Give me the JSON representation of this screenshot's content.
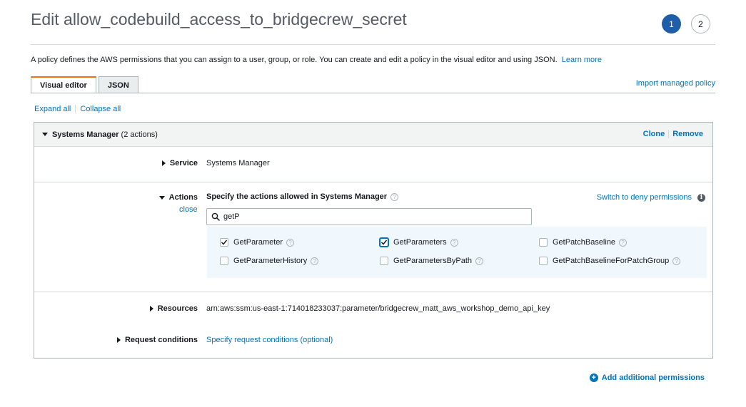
{
  "page": {
    "title": "Edit allow_codebuild_access_to_bridgecrew_secret",
    "steps": [
      "1",
      "2"
    ],
    "intro": "A policy defines the AWS permissions that you can assign to a user, group, or role. You can create and edit a policy in the visual editor and using JSON.",
    "learn_more": "Learn more"
  },
  "tabs": [
    {
      "label": "Visual editor",
      "active": true
    },
    {
      "label": "JSON",
      "active": false
    }
  ],
  "import_link": "Import managed policy",
  "expand_all": "Expand all",
  "collapse_all": "Collapse all",
  "panel": {
    "service_name": "Systems Manager",
    "action_count": "(2 actions)",
    "clone": "Clone",
    "remove": "Remove",
    "service_label": "Service",
    "service_value": "Systems Manager",
    "actions_label": "Actions",
    "close": "close",
    "actions_heading": "Specify the actions allowed in Systems Manager",
    "deny_link": "Switch to deny permissions",
    "search_value": "getP",
    "resources_label": "Resources",
    "resources_value": "arn:aws:ssm:us-east-1:714018233037:parameter/bridgecrew_matt_aws_workshop_demo_api_key",
    "conditions_label": "Request conditions",
    "conditions_link": "Specify request conditions (optional)"
  },
  "actions": [
    {
      "label": "GetParameter",
      "checked": true
    },
    {
      "label": "GetParameters",
      "checked": true
    },
    {
      "label": "GetPatchBaseline",
      "checked": false
    },
    {
      "label": "GetParameterHistory",
      "checked": false
    },
    {
      "label": "GetParametersByPath",
      "checked": false
    },
    {
      "label": "GetPatchBaselineForPatchGroup",
      "checked": false
    }
  ],
  "add_permissions": "Add additional permissions",
  "icons": {
    "search": "search-icon",
    "help": "help-icon",
    "info": "info-icon",
    "plus": "plus-circle-icon"
  },
  "colors": {
    "accent": "#0073bb",
    "step_active": "#1f5ea8",
    "tab_active_border": "#ec7211",
    "action_grid_bg": "#f1f8fd"
  }
}
